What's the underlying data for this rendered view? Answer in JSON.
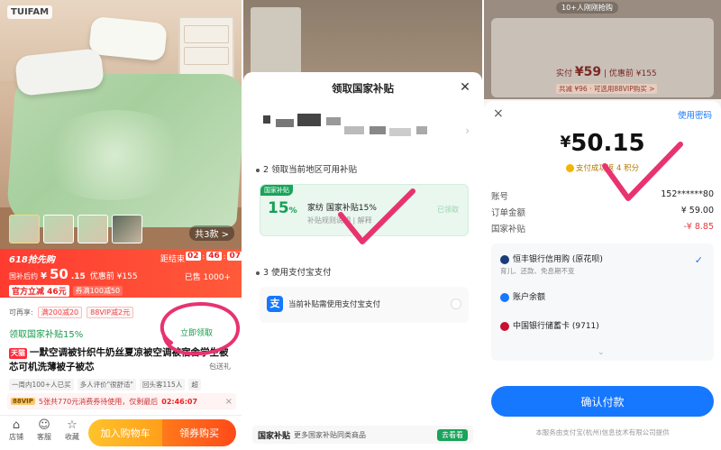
{
  "panel1": {
    "photo_badge": "TUIFAM",
    "thumb_count": "共3款 >",
    "price_bar": {
      "promo_name": "618抢先购",
      "countdown_label": "距结束",
      "countdown": [
        "02",
        "46",
        "07"
      ],
      "price_label": "国补后约",
      "currency": "¥",
      "price_int": "50",
      "price_cents": ".15",
      "orig_price": "优惠前 ¥155",
      "sold": "已售 1000+",
      "coupon_main": "官方立减 46元",
      "coupon_sub": "券满100减50"
    },
    "promo_row": {
      "label": "可再享:",
      "tag1": "满200减20",
      "tag2": "88VIP减2元"
    },
    "subsidy": "领取国家补贴15%",
    "claim": "立即领取",
    "title_badge": "天猫",
    "title": "一默空调被针织牛奶丝夏凉被空调被宿舍学生被芯可机洗薄被子被芯",
    "ship": "包送礼",
    "tags": [
      "一周内100+人已买",
      "多人评价\"很舒适\"",
      "回头客115人",
      "超"
    ],
    "vip": {
      "badge": "88VIP",
      "text": "5张共770元消费券待使用，仅剩最后",
      "timer": "02:46:07"
    },
    "nav": {
      "shop": "店铺",
      "service": "客服",
      "fav": "收藏",
      "cart": "加入购物车",
      "buy": "领券购买"
    }
  },
  "panel2": {
    "title": "领取国家补贴",
    "step2": "2 领取当前地区可用补贴",
    "coupon": {
      "tag": "国家补贴",
      "pct": "15",
      "pct_unit": "%",
      "title": "家纺 国家补贴15%",
      "rule": "补贴规则说明 | 解释",
      "status": "已领取"
    },
    "step3": "3 使用支付宝支付",
    "pay_text": "当前补贴需使用支付宝支付",
    "alipay_glyph": "支",
    "footer": {
      "title": "国家补贴",
      "text": "更多国家补贴同类商品",
      "btn": "去看看"
    }
  },
  "panel3": {
    "live": "10+人刚刚抢购",
    "price_label": "实付",
    "price_value": "¥59",
    "price_orig": "| 优惠前 ¥155",
    "tag": "共减 ¥96 · 可选用88VIP购买 >",
    "close": "×",
    "pwd": "使用密码",
    "currency": "¥",
    "amount": "50.15",
    "success": "支付成功返 4 积分",
    "rows": [
      {
        "k": "账号",
        "v": "152******80"
      },
      {
        "k": "订单金额",
        "v": "¥ 59.00"
      },
      {
        "k": "国家补贴",
        "v": "-¥ 8.85"
      }
    ],
    "methods": {
      "m1": "恒丰银行信用购 (原花呗)",
      "m1_sub": "育儿、还款、免息期不变",
      "m2": "账户余额",
      "m3": "中国银行储蓄卡 (9711)"
    },
    "confirm": "确认付款",
    "foot": "本服务由支付宝(杭州)信息技术有限公司提供"
  },
  "colors": {
    "accent_red": "#ff3b30",
    "subsidy_green": "#1aa35a",
    "alipay_blue": "#1677ff",
    "annotation_pink": "#e8336f"
  }
}
